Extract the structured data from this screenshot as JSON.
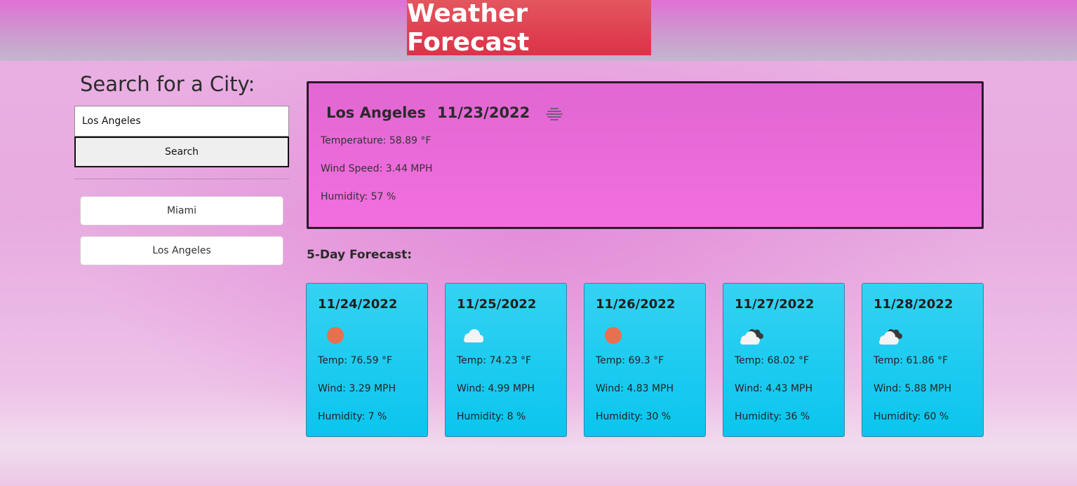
{
  "header": {
    "title": "Weather Forecast"
  },
  "search": {
    "heading": "Search for a City:",
    "value": "Los Angeles",
    "button_label": "Search"
  },
  "history": [
    {
      "label": "Miami"
    },
    {
      "label": "Los Angeles"
    }
  ],
  "current": {
    "city": "Los Angeles",
    "date": "11/23/2022",
    "icon": "mist-icon",
    "temperature": "Temperature: 58.89 °F",
    "wind": "Wind Speed: 3.44 MPH",
    "humidity": "Humidity: 57 %"
  },
  "forecast": {
    "heading": "5-Day Forecast:",
    "days": [
      {
        "date": "11/24/2022",
        "icon": "sun-icon",
        "temp": "Temp: 76.59 °F",
        "wind": "Wind: 3.29 MPH",
        "humidity": "Humidity: 7 %"
      },
      {
        "date": "11/25/2022",
        "icon": "cloud-icon",
        "temp": "Temp: 74.23 °F",
        "wind": "Wind: 4.99 MPH",
        "humidity": "Humidity: 8 %"
      },
      {
        "date": "11/26/2022",
        "icon": "sun-icon",
        "temp": "Temp: 69.3 °F",
        "wind": "Wind: 4.83 MPH",
        "humidity": "Humidity: 30 %"
      },
      {
        "date": "11/27/2022",
        "icon": "broken-clouds-icon",
        "temp": "Temp: 68.02 °F",
        "wind": "Wind: 4.43 MPH",
        "humidity": "Humidity: 36 %"
      },
      {
        "date": "11/28/2022",
        "icon": "broken-clouds-icon",
        "temp": "Temp: 61.86 °F",
        "wind": "Wind: 5.88 MPH",
        "humidity": "Humidity: 60 %"
      }
    ]
  },
  "colors": {
    "title_bg": "#dc3248",
    "current_bg": "#e969d9",
    "card_bg": "#1ecbf0",
    "sun": "#e8704e"
  }
}
